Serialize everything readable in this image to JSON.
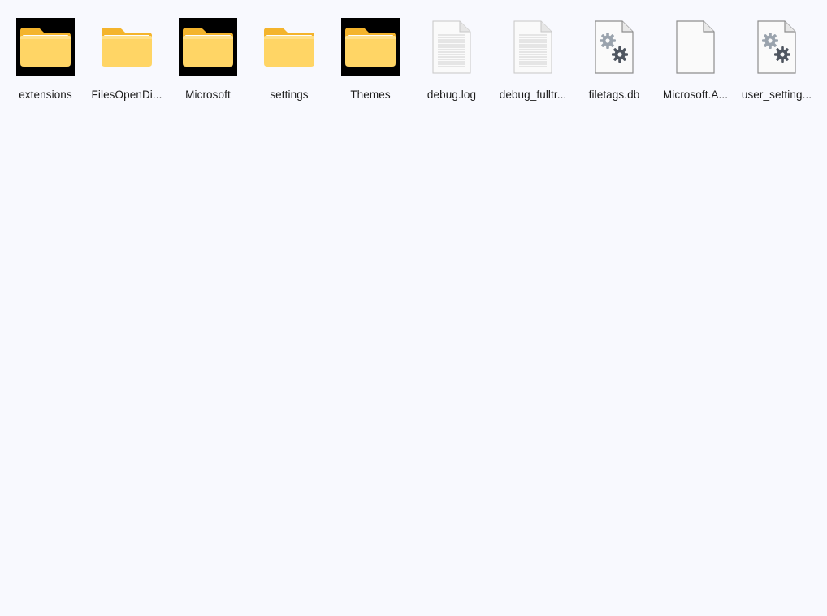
{
  "files": [
    {
      "name": "extensions",
      "icon": "folder-icon",
      "type": "folder"
    },
    {
      "name": "FilesOpenDi...",
      "icon": "folder-icon",
      "type": "folder"
    },
    {
      "name": "Microsoft",
      "icon": "folder-icon",
      "type": "folder"
    },
    {
      "name": "settings",
      "icon": "folder-icon",
      "type": "folder"
    },
    {
      "name": "Themes",
      "icon": "folder-icon",
      "type": "folder"
    },
    {
      "name": "debug.log",
      "icon": "text-document-icon",
      "type": "text"
    },
    {
      "name": "debug_fulltr...",
      "icon": "text-document-icon",
      "type": "text"
    },
    {
      "name": "filetags.db",
      "icon": "settings-file-icon",
      "type": "config"
    },
    {
      "name": "Microsoft.A...",
      "icon": "blank-file-icon",
      "type": "blank"
    },
    {
      "name": "user_setting...",
      "icon": "settings-file-icon",
      "type": "config"
    }
  ],
  "colors": {
    "background": "#f8f9fe",
    "folder_back": "#f4b42c",
    "folder_front": "#ffd565",
    "thumb_dark_bg": "#000000",
    "text": "#1b1b1b"
  }
}
